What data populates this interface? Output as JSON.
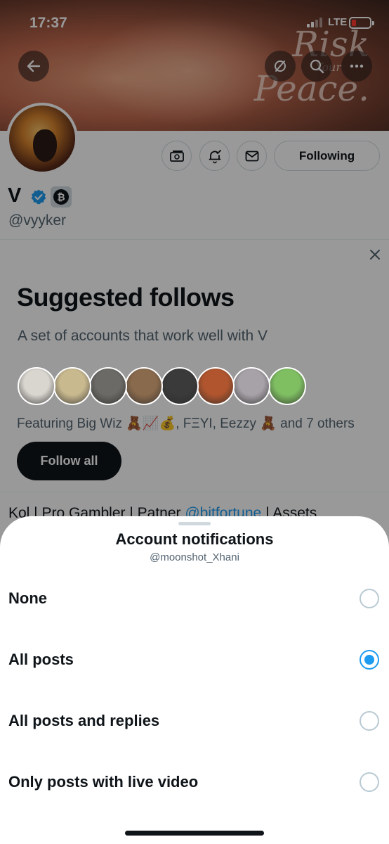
{
  "status": {
    "time": "17:37",
    "network": "LTE"
  },
  "banner": {
    "art_line1": "Risk",
    "art_line2": "Your",
    "art_line3": "Peace."
  },
  "profile": {
    "name": "V",
    "handle": "@vyyker",
    "following_label": "Following",
    "badge_letter": "₿"
  },
  "suggested": {
    "title": "Suggested follows",
    "subtitle": "A set of accounts that work well with V",
    "featuring": "Featuring Big Wiz 🧸📈💰, FΞYI, Eezzy 🧸 and 7 others",
    "follow_all_label": "Follow all",
    "avatar_colors": [
      "#d9d5cf",
      "#c9b98f",
      "#6b6a66",
      "#8a6a4c",
      "#3a3a3a",
      "#b0552d",
      "#a7a2a8",
      "#7fbf62"
    ]
  },
  "bio": {
    "before": "Kol | Pro Gambler | Patner ",
    "link": "@bitfortune",
    "after": " | Assets"
  },
  "sheet": {
    "title": "Account notifications",
    "subtitle": "@moonshot_Xhani",
    "options": [
      {
        "label": "None",
        "selected": false
      },
      {
        "label": "All posts",
        "selected": true
      },
      {
        "label": "All posts and replies",
        "selected": false
      },
      {
        "label": "Only posts with live video",
        "selected": false
      }
    ]
  },
  "colors": {
    "accent": "#1d9bf0",
    "text": "#0f1419",
    "muted": "#536471"
  }
}
